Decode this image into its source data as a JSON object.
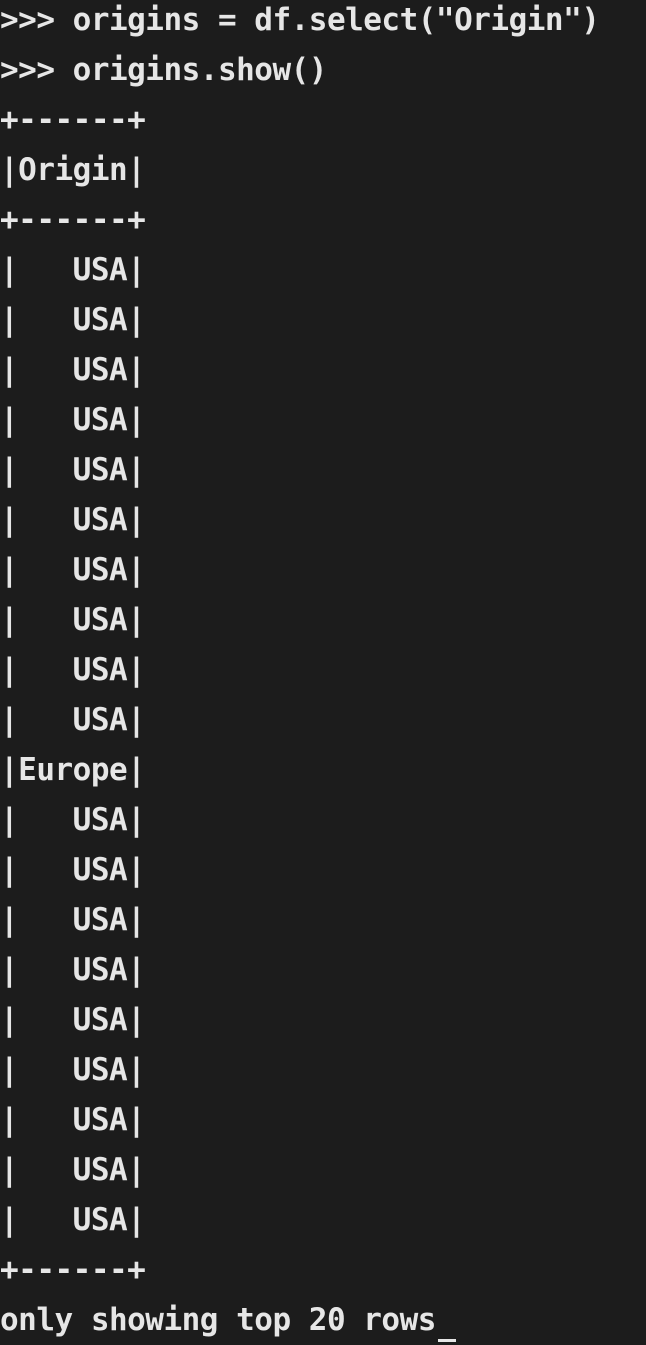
{
  "terminal": {
    "lines": [
      ">>> origins = df.select(\"Origin\")",
      ">>> origins.show()",
      "+------+",
      "|Origin|",
      "+------+",
      "|   USA|",
      "|   USA|",
      "|   USA|",
      "|   USA|",
      "|   USA|",
      "|   USA|",
      "|   USA|",
      "|   USA|",
      "|   USA|",
      "|   USA|",
      "|Europe|",
      "|   USA|",
      "|   USA|",
      "|   USA|",
      "|   USA|",
      "|   USA|",
      "|   USA|",
      "|   USA|",
      "|   USA|",
      "|   USA|",
      "+------+",
      "only showing top 20 rows"
    ]
  }
}
